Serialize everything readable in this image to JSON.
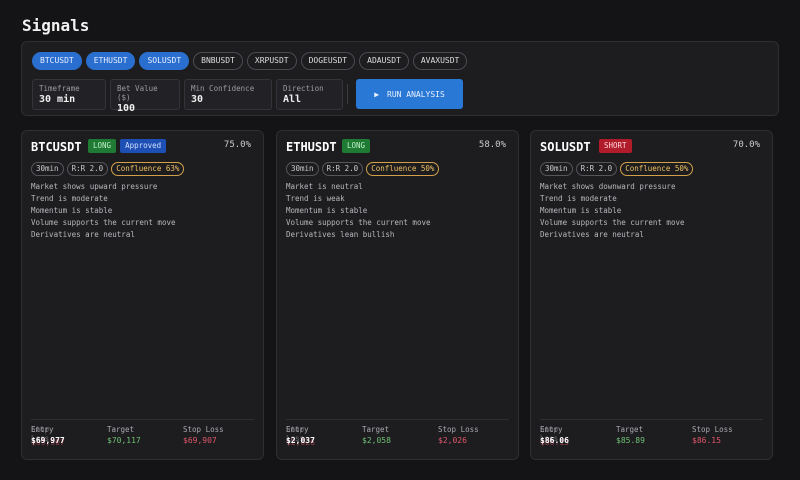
{
  "title": "Signals",
  "symbols": [
    {
      "label": "BTCUSDT",
      "active": true
    },
    {
      "label": "ETHUSDT",
      "active": true
    },
    {
      "label": "SOLUSDT",
      "active": true
    },
    {
      "label": "BNBUSDT",
      "active": false
    },
    {
      "label": "XRPUSDT",
      "active": false
    },
    {
      "label": "DOGEUSDT",
      "active": false
    },
    {
      "label": "ADAUSDT",
      "active": false
    },
    {
      "label": "AVAXUSDT",
      "active": false
    }
  ],
  "fields": [
    {
      "label": "Timeframe",
      "value": "30 min"
    },
    {
      "label": "Bet Value ($)",
      "value": "100"
    },
    {
      "label": "Min Confidence",
      "value": "30"
    },
    {
      "label": "Direction",
      "value": "All"
    }
  ],
  "run": {
    "icon": "▶",
    "label": "RUN ANALYSIS"
  },
  "labels": {
    "entry": "Entry",
    "target": "Target",
    "stop": "Stop Loss"
  },
  "cards": [
    {
      "symbol": "BTCUSDT",
      "direction": "LONG",
      "status": "Approved",
      "confidence": "75.0%",
      "timeframe": "30min",
      "rr": "R:R 2.0",
      "confluence": "Confluence 63%",
      "notes": [
        "Market shows upward pressure",
        "Trend is moderate",
        "Momentum is stable",
        "Volume supports the current move",
        "Derivatives are neutral"
      ],
      "entry": "$69,977",
      "target": "$70,117",
      "stop": "$69,907"
    },
    {
      "symbol": "ETHUSDT",
      "direction": "LONG",
      "status": null,
      "confidence": "58.0%",
      "timeframe": "30min",
      "rr": "R:R 2.0",
      "confluence": "Confluence 50%",
      "notes": [
        "Market is neutral",
        "Trend is weak",
        "Momentum is stable",
        "Volume supports the current move",
        "Derivatives lean bullish"
      ],
      "entry": "$2,037",
      "target": "$2,058",
      "stop": "$2,026"
    },
    {
      "symbol": "SOLUSDT",
      "direction": "SHORT",
      "status": null,
      "confidence": "70.0%",
      "timeframe": "30min",
      "rr": "R:R 2.0",
      "confluence": "Confluence 50%",
      "notes": [
        "Market shows downward pressure",
        "Trend is moderate",
        "Momentum is stable",
        "Volume supports the current move",
        "Derivatives are neutral"
      ],
      "entry": "$86.06",
      "target": "$85.89",
      "stop": "$86.15"
    }
  ],
  "colors": {
    "accent": "#2a78d6",
    "long": "#1f7a34",
    "short": "#b01c2a",
    "target": "#6fbf73",
    "stop": "#e0566a"
  }
}
